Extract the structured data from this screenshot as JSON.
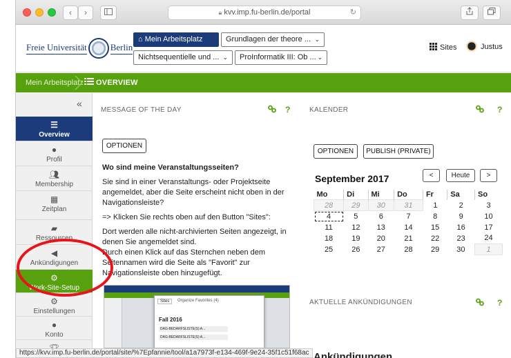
{
  "browser": {
    "url": "kvv.imp.fu-berlin.de/portal",
    "status_url": "https://kvv.imp.fu-berlin.de/portal/site/%7Epfannie/tool/a1a7973f-e134-469f-9e24-35f1c51f68ac"
  },
  "header": {
    "logo_left": "Freie Universität",
    "logo_right": "Berlin",
    "nav": {
      "my_workspace": "Mein Arbeitsplatz",
      "site1": "Grundlagen der theore ...",
      "site2": "Nichtsequentielle und ...",
      "site3": "ProInformatik III: Ob ..."
    },
    "sites_label": "Sites",
    "user_name": "Justus"
  },
  "breadcrumb": {
    "home": "Mein Arbeitsplatz",
    "current": "OVERVIEW"
  },
  "sidebar": {
    "items": [
      {
        "label": "Overview",
        "icon": "list-icon"
      },
      {
        "label": "Profil",
        "icon": "user-icon"
      },
      {
        "label": "Membership",
        "icon": "users-icon"
      },
      {
        "label": "Zeitplan",
        "icon": "calendar-icon"
      },
      {
        "label": "Ressourcen",
        "icon": "folder-icon"
      },
      {
        "label": "Ankündigungen",
        "icon": "bullhorn-icon"
      },
      {
        "label": "Work-Site-Setup",
        "icon": "cogs-icon"
      },
      {
        "label": "Einstellungen",
        "icon": "gear-icon"
      },
      {
        "label": "Konto",
        "icon": "user-icon"
      },
      {
        "label": "",
        "icon": "trophy-icon"
      }
    ]
  },
  "motd": {
    "title": "MESSAGE OF THE DAY",
    "options": "OPTIONEN",
    "heading": "Wo sind meine Veranstaltungsseiten?",
    "p1": "Sie sind in einer Veranstaltungs- oder Projektseite angemeldet, aber die Seite erscheint nicht oben in der Navigationsleiste?",
    "p2": "=> Klicken Sie rechts oben auf den Button \"Sites\":",
    "p3a": "Dort werden alle nicht-archivierten Seiten angezeigt, in denen Sie angemeldet sind.",
    "p3b": "Durch einen Klick auf das Sternchen neben dem Seitennamen wird die Seite als \"Favorit\" zur Navigationsleiste oben hinzugefügt.",
    "help": "?",
    "shot": {
      "tab_sites": "Sites",
      "tab_fav": "Organize Favorites (4)",
      "term": "Fall 2016",
      "row1": "DAG-BEDARFSLISTE(S) A...",
      "row2": "DAG-BEDARFSLISTE(S) A..."
    }
  },
  "calendar": {
    "title": "KALENDER",
    "options": "OPTIONEN",
    "publish": "PUBLISH (PRIVATE)",
    "month": "September 2017",
    "prev": "<",
    "today": "Heute",
    "next": ">",
    "help": "?",
    "weekdays": [
      "Mo",
      "Di",
      "Mi",
      "Do",
      "Fr",
      "Sa",
      "So"
    ],
    "weeks": [
      [
        "28",
        "29",
        "30",
        "31",
        "1",
        "2",
        "3"
      ],
      [
        "4",
        "5",
        "6",
        "7",
        "8",
        "9",
        "10"
      ],
      [
        "11",
        "12",
        "13",
        "14",
        "15",
        "16",
        "17"
      ],
      [
        "18",
        "19",
        "20",
        "21",
        "22",
        "23",
        "24"
      ],
      [
        "25",
        "26",
        "27",
        "28",
        "29",
        "30",
        "1"
      ]
    ]
  },
  "announcements": {
    "title": "AKTUELLE ANKÜNDIGUNGEN",
    "heading": "Ankündigungen",
    "help": "?"
  },
  "colors": {
    "brand_blue": "#1b3b7a",
    "brand_green": "#56a10d",
    "annotation_red": "#e8141c"
  }
}
